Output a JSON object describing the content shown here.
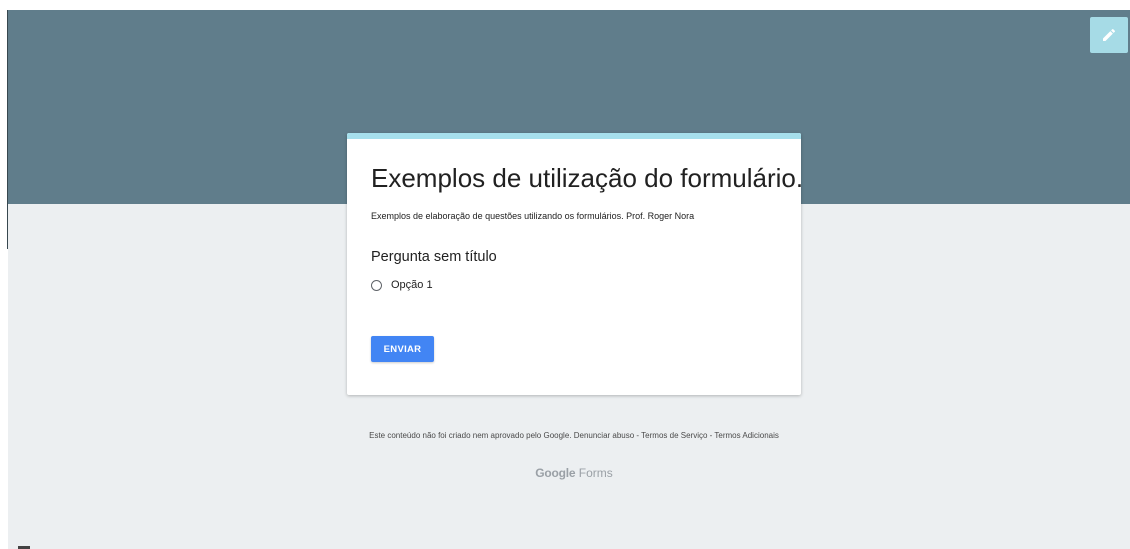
{
  "form": {
    "title": "Exemplos de utilização do formulário.",
    "description": "Exemplos de elaboração de questões utilizando os formulários.  Prof. Roger Nora",
    "question": {
      "title": "Pergunta sem título",
      "options": [
        "Opção 1"
      ]
    },
    "submit_label": "ENVIAR"
  },
  "footer": {
    "disclaimer": "Este conteúdo não foi criado nem aprovado pelo Google.",
    "report_abuse": "Denunciar abuso",
    "separator": " - ",
    "terms_of_service": "Termos de Serviço",
    "additional_terms": "Termos Adicionais"
  },
  "branding": {
    "google": "Google",
    "product": "Forms"
  },
  "icons": {
    "edit": "pencil-icon"
  },
  "colors": {
    "header": "#607d8b",
    "background": "#eceff1",
    "accent": "#a6dfec",
    "submit": "#4285f4",
    "edit_button": "#a6dbe6"
  }
}
